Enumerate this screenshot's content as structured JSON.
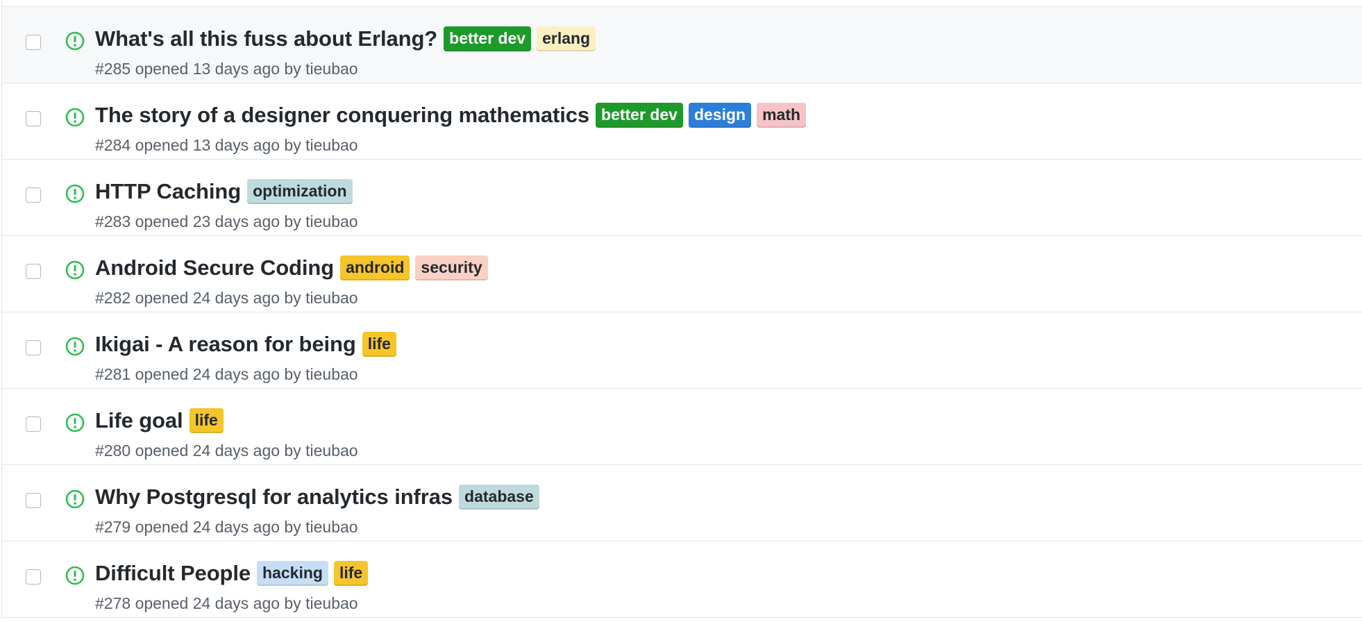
{
  "issues": [
    {
      "title": "What's all this fuss about Erlang?",
      "number": "#285",
      "opened": "opened 13 days ago by",
      "author": "tieubao",
      "hovered": true,
      "labels": [
        {
          "name": "better dev",
          "bg": "#1e9a2a",
          "fg": "#ffffff"
        },
        {
          "name": "erlang",
          "bg": "#fcf0c2",
          "fg": "#24292e"
        }
      ]
    },
    {
      "title": "The story of a designer conquering mathematics",
      "number": "#284",
      "opened": "opened 13 days ago by",
      "author": "tieubao",
      "hovered": false,
      "labels": [
        {
          "name": "better dev",
          "bg": "#1e9a2a",
          "fg": "#ffffff"
        },
        {
          "name": "design",
          "bg": "#2b7fd9",
          "fg": "#ffffff"
        },
        {
          "name": "math",
          "bg": "#f6c4c6",
          "fg": "#24292e"
        }
      ]
    },
    {
      "title": "HTTP Caching",
      "number": "#283",
      "opened": "opened 23 days ago by",
      "author": "tieubao",
      "hovered": false,
      "labels": [
        {
          "name": "optimization",
          "bg": "#bfdadc",
          "fg": "#24292e"
        }
      ]
    },
    {
      "title": "Android Secure Coding",
      "number": "#282",
      "opened": "opened 24 days ago by",
      "author": "tieubao",
      "hovered": false,
      "labels": [
        {
          "name": "android",
          "bg": "#f5c52a",
          "fg": "#24292e"
        },
        {
          "name": "security",
          "bg": "#f9d0c4",
          "fg": "#24292e"
        }
      ]
    },
    {
      "title": "Ikigai - A reason for being",
      "number": "#281",
      "opened": "opened 24 days ago by",
      "author": "tieubao",
      "hovered": false,
      "labels": [
        {
          "name": "life",
          "bg": "#f5c52a",
          "fg": "#24292e"
        }
      ]
    },
    {
      "title": "Life goal",
      "number": "#280",
      "opened": "opened 24 days ago by",
      "author": "tieubao",
      "hovered": false,
      "labels": [
        {
          "name": "life",
          "bg": "#f5c52a",
          "fg": "#24292e"
        }
      ]
    },
    {
      "title": "Why Postgresql for analytics infras",
      "number": "#279",
      "opened": "opened 24 days ago by",
      "author": "tieubao",
      "hovered": false,
      "labels": [
        {
          "name": "database",
          "bg": "#bfdadc",
          "fg": "#24292e"
        }
      ]
    },
    {
      "title": "Difficult People",
      "number": "#278",
      "opened": "opened 24 days ago by",
      "author": "tieubao",
      "hovered": false,
      "labels": [
        {
          "name": "hacking",
          "bg": "#c5def5",
          "fg": "#24292e"
        },
        {
          "name": "life",
          "bg": "#f5c52a",
          "fg": "#24292e"
        }
      ]
    }
  ],
  "icons": {
    "status": "issue-opened-icon"
  },
  "colors": {
    "open_status": "#2cbe4e",
    "row_hover": "#f6f8fa"
  }
}
